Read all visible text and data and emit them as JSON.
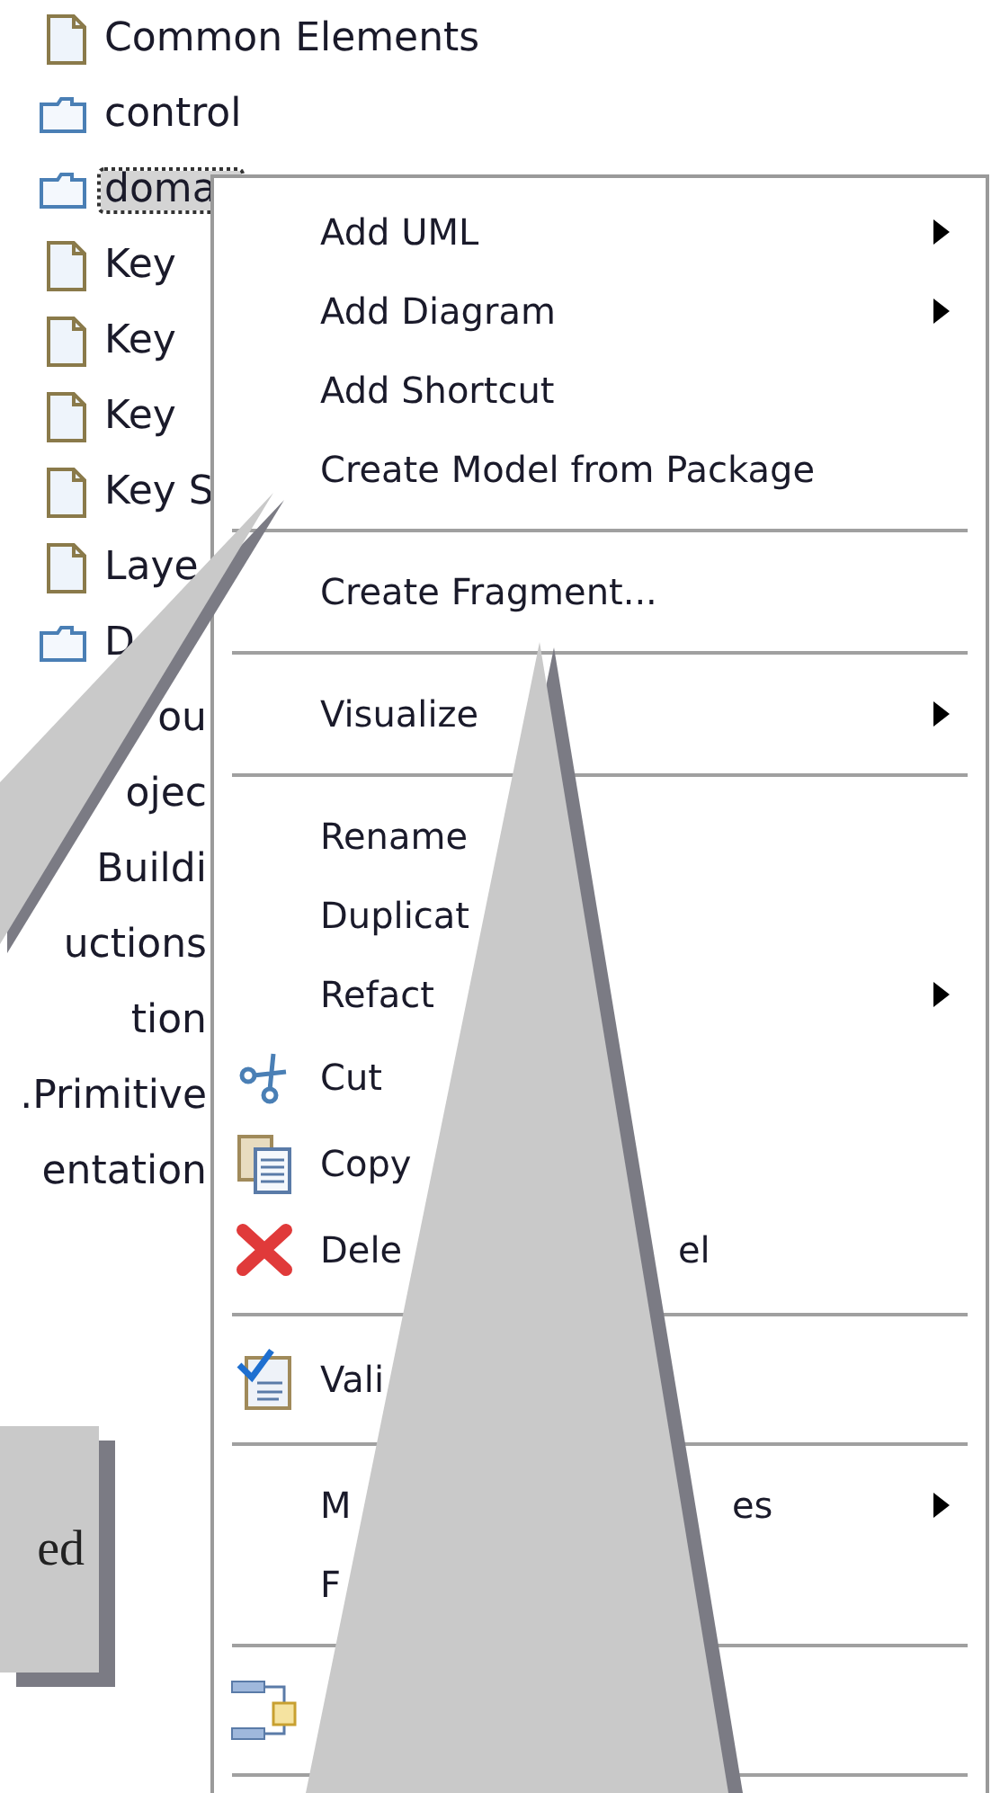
{
  "tree": {
    "items": [
      {
        "kind": "document",
        "label": "Common Elements",
        "selected": false
      },
      {
        "kind": "folder",
        "label": "control",
        "selected": false
      },
      {
        "kind": "folder",
        "label": "doma",
        "selected": true
      },
      {
        "kind": "document",
        "label": "Key",
        "selected": false
      },
      {
        "kind": "document",
        "label": "Key",
        "selected": false
      },
      {
        "kind": "document",
        "label": "Key",
        "selected": false
      },
      {
        "kind": "document",
        "label": "Key S",
        "selected": false
      },
      {
        "kind": "document",
        "label": "Laye",
        "selected": false
      },
      {
        "kind": "folder",
        "label": "D",
        "selected": false
      },
      {
        "kind": "text",
        "label": "ou",
        "selected": false
      },
      {
        "kind": "text",
        "label": "ojec",
        "selected": false
      },
      {
        "kind": "text",
        "label": "Buildi",
        "selected": false
      },
      {
        "kind": "text",
        "label": "uctions",
        "selected": false
      },
      {
        "kind": "text",
        "label": "tion",
        "selected": false
      },
      {
        "kind": "text",
        "label": ".Primitive",
        "selected": false
      },
      {
        "kind": "text",
        "label": "entation",
        "selected": false
      }
    ]
  },
  "context_menu": {
    "items": [
      {
        "kind": "item",
        "label": "Add UML",
        "submenu": true
      },
      {
        "kind": "item",
        "label": "Add Diagram",
        "submenu": true
      },
      {
        "kind": "item",
        "label": "Add Shortcut",
        "submenu": false
      },
      {
        "kind": "item",
        "label": "Create Model from Package",
        "submenu": false
      },
      {
        "kind": "separator"
      },
      {
        "kind": "item",
        "label": "Create Fragment...",
        "submenu": false
      },
      {
        "kind": "separator"
      },
      {
        "kind": "item",
        "label": "Visualize",
        "submenu": true
      },
      {
        "kind": "separator"
      },
      {
        "kind": "item",
        "label": "Rename",
        "submenu": false
      },
      {
        "kind": "item",
        "label": "Duplicat",
        "submenu": false
      },
      {
        "kind": "item",
        "label": "Refact",
        "submenu": true
      },
      {
        "kind": "cut",
        "label": "Cut",
        "submenu": false
      },
      {
        "kind": "copy",
        "label": "Copy",
        "submenu": false
      },
      {
        "kind": "delete",
        "label": "Dele",
        "label_end": "el",
        "submenu": false
      },
      {
        "kind": "separator"
      },
      {
        "kind": "validate",
        "label": "Vali",
        "submenu": false
      },
      {
        "kind": "separator"
      },
      {
        "kind": "item",
        "label": "M",
        "label_end": "es",
        "submenu": true
      },
      {
        "kind": "item",
        "label": "F",
        "submenu": false
      },
      {
        "kind": "separator"
      },
      {
        "kind": "diagram",
        "submenu": false
      },
      {
        "kind": "separator"
      }
    ]
  },
  "callout": {
    "text": "ed"
  }
}
